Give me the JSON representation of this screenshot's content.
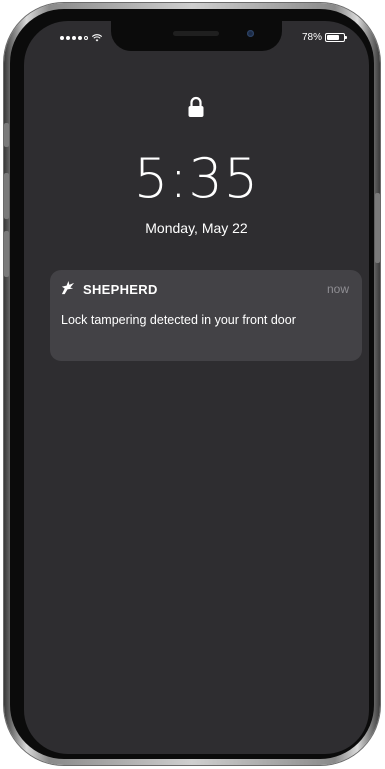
{
  "status_bar": {
    "battery_text": "78%",
    "battery_level": 0.78,
    "signal_bars_filled": 4,
    "signal_bars_total": 5
  },
  "lock_screen": {
    "time": "5:35",
    "date": "Monday, May 22"
  },
  "notification": {
    "app_name": "SHEPHERD",
    "time": "now",
    "message": "Lock tampering detected in your front door"
  },
  "colors": {
    "screen_background": "#2e2d30",
    "notification_background": "#434246",
    "secondary_text": "#8f8e93"
  },
  "icons": {
    "lock": "lock-icon",
    "app": "shepherd-bird-icon",
    "wifi": "wifi-icon",
    "battery": "battery-icon"
  }
}
